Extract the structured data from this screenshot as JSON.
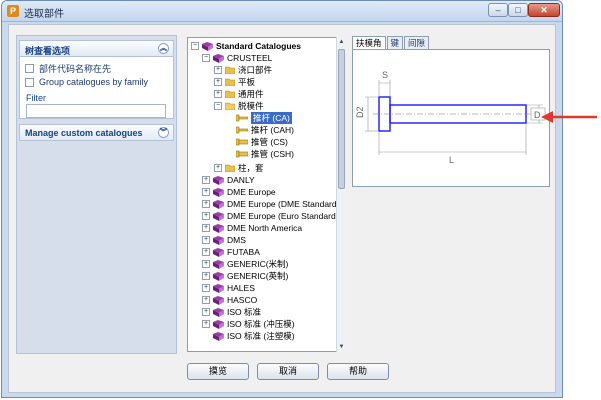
{
  "window": {
    "title": "选取部件",
    "app_icon": "P",
    "controls": {
      "minimize": "–",
      "maximize": "□",
      "close": "✕"
    }
  },
  "view_options": {
    "title": "树查看选项",
    "collapse_icon": "collapse-up-icon",
    "checkbox_part_code_first": {
      "label": "部件代码名称在先",
      "checked": false
    },
    "checkbox_group_by_family": {
      "label": "Group catalogues by family",
      "checked": false
    },
    "filter_label": "Filter",
    "filter_value": ""
  },
  "manage_custom": {
    "title": "Manage custom catalogues",
    "expand_icon": "expand-down-icon"
  },
  "tree": {
    "root": "Standard Catalogues",
    "crusteel": "CRUSTEEL",
    "crusteel_children": [
      "浇口部件",
      "平板",
      "通用件"
    ],
    "ejector_parts": "脱模件",
    "ejector_children": [
      "推杆 (CA)",
      "推杆 (CAH)",
      "推管 (CS)",
      "推管 (CSH)"
    ],
    "selected_item": "推杆 (CA)",
    "pillar_sleeve": "柱，套",
    "catalogues": [
      "DANLY",
      "DME Europe",
      "DME Europe (DME Standard)",
      "DME Europe (Euro Standard)",
      "DME North America",
      "DMS",
      "FUTABA",
      "GENERIC(米制)",
      "GENERIC(英制)",
      "HALES",
      "HASCO",
      "ISO 标准",
      "ISO 标准 (冲压模)",
      "ISO 标准 (注塑模)"
    ]
  },
  "preview": {
    "tabs": [
      "扶模角",
      "键",
      "间隙"
    ],
    "active_tab": "扶模角",
    "dims": {
      "s": "S",
      "d2": "D2",
      "d": "D",
      "l": "L"
    },
    "line_color": "#1a1aff",
    "arrow_color": "#e03a2e"
  },
  "buttons": {
    "browse": "摸览",
    "cancel": "取消",
    "help": "帮助"
  }
}
